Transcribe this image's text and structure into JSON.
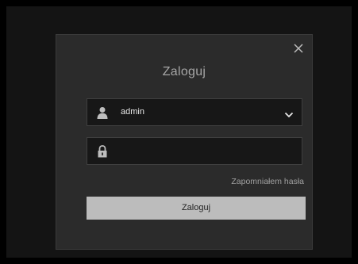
{
  "dialog": {
    "title": "Zaloguj",
    "close_icon": "close-icon"
  },
  "username": {
    "icon": "user-icon",
    "value": "admin",
    "dropdown_icon": "chevron-down-icon"
  },
  "password": {
    "icon": "lock-icon",
    "value": ""
  },
  "forgot_password": "Zapomniałem hasła",
  "login_button": "Zaloguj",
  "colors": {
    "background": "#000000",
    "dialog": "#2b2b2b",
    "field": "#171717",
    "button": "#bcbcbc",
    "text_muted": "#a6a6a6"
  }
}
